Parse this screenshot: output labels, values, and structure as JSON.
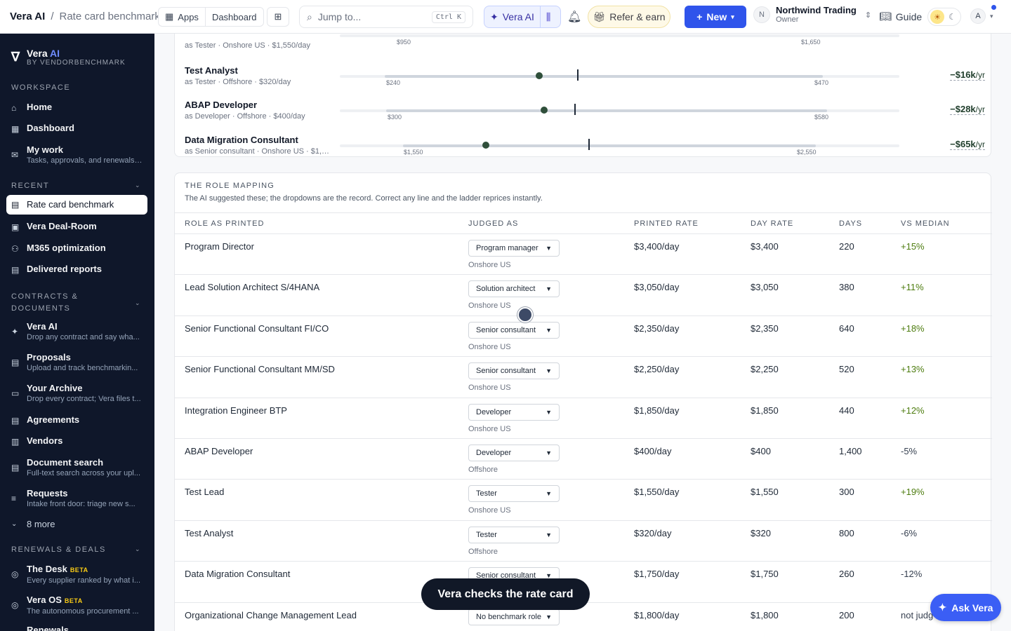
{
  "topbar": {
    "app": "Vera AI",
    "sep": "/",
    "page": "Rate card benchmark",
    "apps": "Apps",
    "dashboard": "Dashboard",
    "search_placeholder": "Jump to...",
    "shortcut": "Ctrl K",
    "vera": "Vera AI",
    "refer": "Refer & earn",
    "new": "New",
    "org_initial": "N",
    "org_name": "Northwind Trading",
    "org_role": "Owner",
    "guide": "Guide",
    "user_initial": "A"
  },
  "sidebar": {
    "brand": "Vera",
    "brand_ai": "AI",
    "brand_sub": "BY VENDORBENCHMARK",
    "workspace_title": "WORKSPACE",
    "workspace": [
      {
        "icon": "home-icon",
        "glyph": "⌂",
        "label": "Home",
        "sub": ""
      },
      {
        "icon": "dashboard-icon",
        "glyph": "▦",
        "label": "Dashboard",
        "sub": ""
      },
      {
        "icon": "inbox-icon",
        "glyph": "✉",
        "label": "My work",
        "sub": "Tasks, approvals, and renewals ..."
      }
    ],
    "recent_title": "RECENT",
    "recent": [
      {
        "icon": "document-icon",
        "glyph": "▤",
        "label": "Rate card benchmark"
      },
      {
        "icon": "briefcase-icon",
        "glyph": "▣",
        "label": "Vera Deal-Room"
      },
      {
        "icon": "users-icon",
        "glyph": "⚇",
        "label": "M365 optimization"
      },
      {
        "icon": "report-icon",
        "glyph": "▤",
        "label": "Delivered reports"
      }
    ],
    "contracts_title_1": "CONTRACTS &",
    "contracts_title_2": "DOCUMENTS",
    "contracts": [
      {
        "icon": "sparkle-icon",
        "glyph": "✦",
        "label": "Vera AI",
        "sub": "Drop any contract and say wha..."
      },
      {
        "icon": "proposal-icon",
        "glyph": "▤",
        "label": "Proposals",
        "sub": "Upload and track benchmarkin..."
      },
      {
        "icon": "archive-icon",
        "glyph": "▭",
        "label": "Your Archive",
        "sub": "Drop every contract; Vera files t..."
      },
      {
        "icon": "agreement-icon",
        "glyph": "▤",
        "label": "Agreements",
        "sub": ""
      },
      {
        "icon": "vendors-icon",
        "glyph": "▥",
        "label": "Vendors",
        "sub": ""
      },
      {
        "icon": "doc-search-icon",
        "glyph": "▤",
        "label": "Document search",
        "sub": "Full-text search across your upl..."
      },
      {
        "icon": "requests-icon",
        "glyph": "≡",
        "label": "Requests",
        "sub": "Intake front door: triage new s..."
      }
    ],
    "more": "8 more",
    "renewals_title": "RENEWALS & DEALS",
    "renewals": [
      {
        "icon": "target-icon",
        "glyph": "◎",
        "label": "The Desk",
        "beta": "BETA",
        "sub": "Every supplier ranked by what i..."
      },
      {
        "icon": "globe-icon",
        "glyph": "◎",
        "label": "Vera OS",
        "beta": "BETA",
        "sub": "The autonomous procurement ..."
      }
    ],
    "cut_item": "Renewals"
  },
  "ladder": {
    "top_desc": "as Tester · Onshore US · $1,550/day",
    "top_low": "$950",
    "top_high": "$1,650",
    "rows": [
      {
        "name": "Test Analyst",
        "desc": "as Tester · Offshore · $320/day",
        "low": "$240",
        "high": "$470",
        "saving": "−$16k",
        "unit": "/yr"
      },
      {
        "name": "ABAP Developer",
        "desc": "as Developer · Offshore · $400/day",
        "low": "$300",
        "high": "$580",
        "saving": "−$28k",
        "unit": "/yr"
      },
      {
        "name": "Data Migration Consultant",
        "desc": "as Senior consultant · Onshore US · $1,750/day",
        "low": "$1,550",
        "high": "$2,550",
        "saving": "−$65k",
        "unit": "/yr"
      }
    ]
  },
  "mapping": {
    "title": "THE ROLE MAPPING",
    "subtitle": "The AI suggested these; the dropdowns are the record. Correct any line and the ladder reprices instantly.",
    "headers": [
      "ROLE AS PRINTED",
      "JUDGED AS",
      "PRINTED RATE",
      "DAY RATE",
      "DAYS",
      "VS MEDIAN"
    ],
    "rows": [
      {
        "role": "Program Director",
        "judged": "Program manager",
        "loc": "Onshore US",
        "printed": "$3,400/day",
        "day": "$3,400",
        "days": "220",
        "vs": "+15%"
      },
      {
        "role": "Lead Solution Architect S/4HANA",
        "judged": "Solution architect",
        "loc": "Onshore US",
        "printed": "$3,050/day",
        "day": "$3,050",
        "days": "380",
        "vs": "+11%"
      },
      {
        "role": "Senior Functional Consultant FI/CO",
        "judged": "Senior consultant",
        "loc": "Onshore US",
        "printed": "$2,350/day",
        "day": "$2,350",
        "days": "640",
        "vs": "+18%"
      },
      {
        "role": "Senior Functional Consultant MM/SD",
        "judged": "Senior consultant",
        "loc": "Onshore US",
        "printed": "$2,250/day",
        "day": "$2,250",
        "days": "520",
        "vs": "+13%"
      },
      {
        "role": "Integration Engineer BTP",
        "judged": "Developer",
        "loc": "Onshore US",
        "printed": "$1,850/day",
        "day": "$1,850",
        "days": "440",
        "vs": "+12%"
      },
      {
        "role": "ABAP Developer",
        "judged": "Developer",
        "loc": "Offshore",
        "printed": "$400/day",
        "day": "$400",
        "days": "1,400",
        "vs": "-5%"
      },
      {
        "role": "Test Lead",
        "judged": "Tester",
        "loc": "Onshore US",
        "printed": "$1,550/day",
        "day": "$1,550",
        "days": "300",
        "vs": "+19%"
      },
      {
        "role": "Test Analyst",
        "judged": "Tester",
        "loc": "Offshore",
        "printed": "$320/day",
        "day": "$320",
        "days": "800",
        "vs": "-6%"
      },
      {
        "role": "Data Migration Consultant",
        "judged": "Senior consultant",
        "loc": "",
        "printed": "$1,750/day",
        "day": "$1,750",
        "days": "260",
        "vs": "-12%"
      },
      {
        "role": "Organizational Change Management Lead",
        "judged": "No benchmark role",
        "loc": "",
        "printed": "$1,800/day",
        "day": "$1,800",
        "days": "200",
        "vs": "not judg"
      }
    ]
  },
  "toast": "Vera checks the rate card",
  "ask": "Ask Vera"
}
